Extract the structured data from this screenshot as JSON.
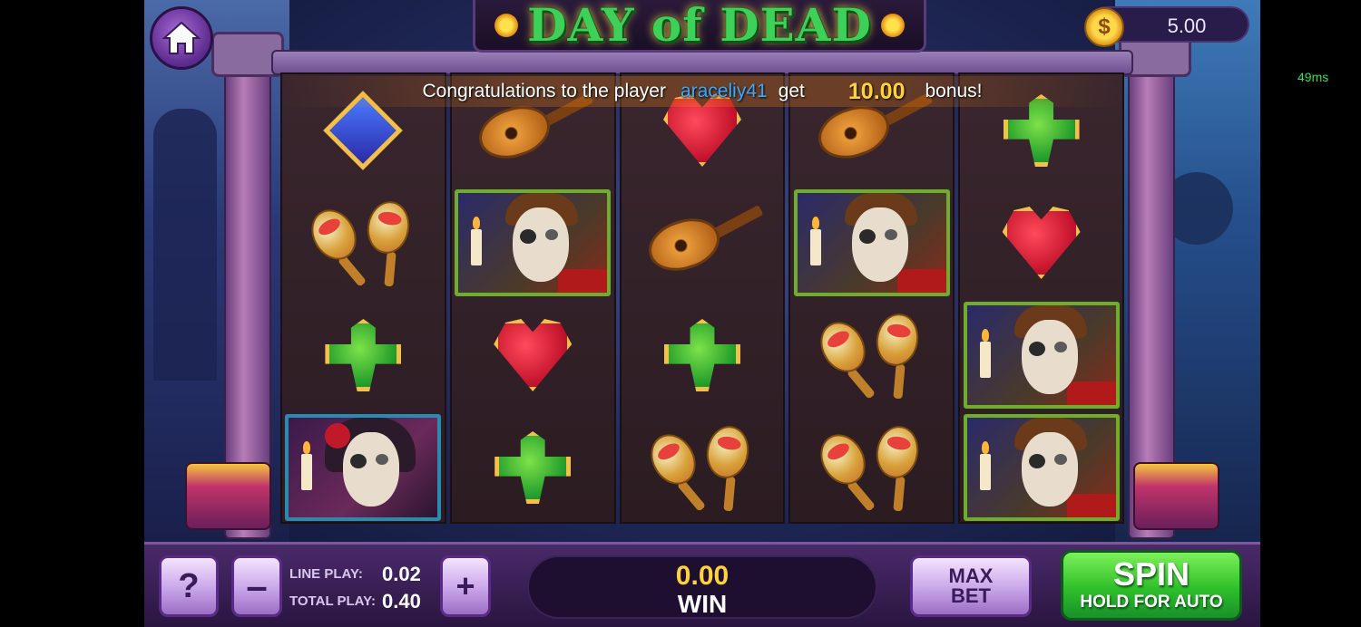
{
  "game": {
    "title": "DAY of DEAD",
    "balance": "5.00",
    "coin_symbol": "$",
    "latency": "49ms"
  },
  "banner": {
    "prefix": "Congratulations to the player",
    "player": "araceliy41",
    "middle": "get",
    "amount": "10.00",
    "suffix": "bonus!"
  },
  "reels": [
    [
      "diamond",
      "maracas",
      "club",
      "portrait-girl"
    ],
    [
      "guitar",
      "portrait-man",
      "heart",
      "club"
    ],
    [
      "heart",
      "guitar",
      "club",
      "maracas"
    ],
    [
      "guitar",
      "portrait-man",
      "maracas",
      "maracas"
    ],
    [
      "club",
      "heart",
      "portrait-man",
      "portrait-man"
    ]
  ],
  "controls": {
    "help_label": "?",
    "minus_label": "–",
    "plus_label": "+",
    "line_play_label": "LINE PLAY:",
    "line_play_value": "0.02",
    "total_play_label": "TOTAL PLAY:",
    "total_play_value": "0.40",
    "win_value": "0.00",
    "win_label": "WIN",
    "max_bet_line1": "MAX",
    "max_bet_line2": "BET",
    "spin_label": "SPIN",
    "spin_sub_label": "HOLD FOR AUTO"
  },
  "icons": {
    "home": "home-icon",
    "coin": "coin-icon"
  },
  "colors": {
    "title_green": "#3ed15a",
    "win_yellow": "#ffd23a",
    "player_blue": "#3aa8ff",
    "spin_green": "#2fc02a",
    "latency_green": "#2ee04a"
  }
}
